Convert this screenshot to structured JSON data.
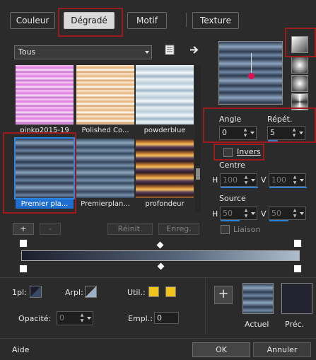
{
  "tabs": [
    "Couleur",
    "Dégradé",
    "Motif",
    "Texture"
  ],
  "library": {
    "filter_value": "Tous",
    "items": [
      {
        "name": "pinkp2015-19"
      },
      {
        "name": "Polished Co..."
      },
      {
        "name": "powderblue"
      },
      {
        "name": "Premier pla..."
      },
      {
        "name": "Premierplan..."
      },
      {
        "name": "profondeur"
      }
    ],
    "add_label": "+",
    "remove_label": "-",
    "reset_label": "Réinit.",
    "save_label": "Enreg."
  },
  "params": {
    "angle_label": "Angle",
    "angle_value": "0",
    "repeat_label": "Répét.",
    "repeat_value": "5",
    "invert_label": "Invers",
    "center_label": "Centre",
    "center_h_label": "H",
    "center_h_value": "100",
    "center_v_label": "V",
    "center_v_value": "100",
    "source_label": "Source",
    "source_h_label": "H",
    "source_h_value": "50",
    "source_v_label": "V",
    "source_v_value": "50",
    "link_label": "Liaison"
  },
  "stops": {
    "onepl_label": "1pl:",
    "arrpl_label": "Arpl:",
    "util_label": "Util.:",
    "opacity_label": "Opacité:",
    "opacity_value": "0",
    "empl_label": "Empl.:",
    "empl_value": "0"
  },
  "current": {
    "actual_label": "Actuel",
    "previous_label": "Préc.",
    "add_label": "+"
  },
  "footer": {
    "help_label": "Aide",
    "ok_label": "OK",
    "cancel_label": "Annuler"
  },
  "colors": {
    "accent": "#2e7fd6",
    "highlight_box": "#9b1c1c",
    "util_yellow": "#f0c41a",
    "previous_swatch": "#23232f"
  },
  "icons": [
    "palette-icon",
    "arrow-right-icon",
    "linear-gradient-icon",
    "radial-gradient-icon",
    "rectangular-gradient-icon",
    "sunburst-gradient-icon",
    "color-stop-icon",
    "midpoint-icon"
  ]
}
